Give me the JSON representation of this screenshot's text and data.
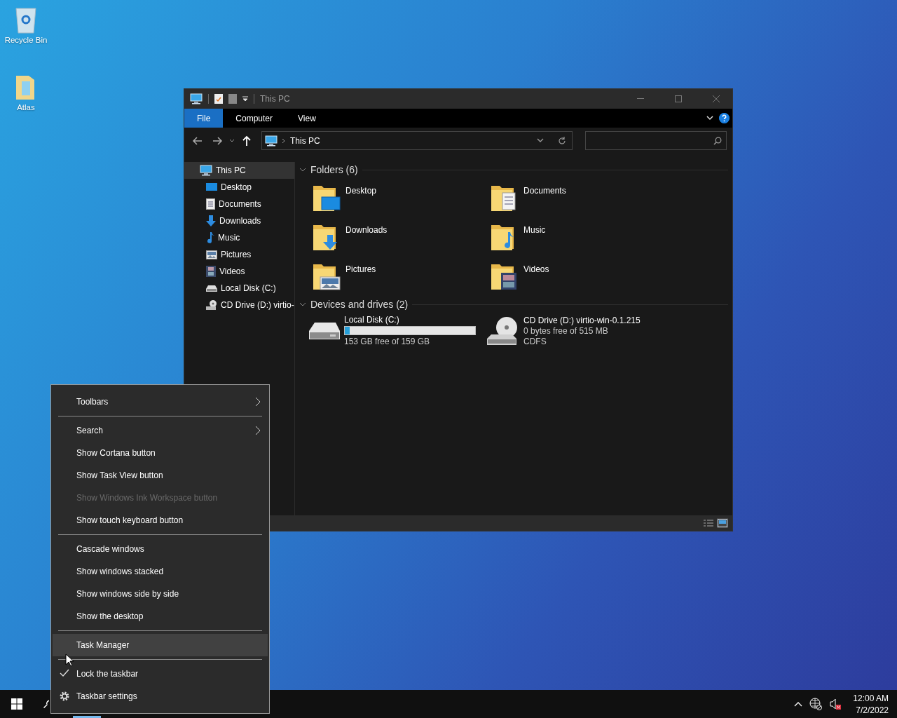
{
  "desktop_icons": [
    {
      "label": "Recycle Bin"
    },
    {
      "label": "Atlas"
    }
  ],
  "explorer": {
    "title": "This PC",
    "ribbon_tabs": [
      {
        "label": "File",
        "selected": true
      },
      {
        "label": "Computer",
        "selected": false
      },
      {
        "label": "View",
        "selected": false
      }
    ],
    "address": "This PC",
    "nav_tree": [
      {
        "label": "This PC",
        "selected": true,
        "children": [
          {
            "label": "Desktop",
            "selected": false
          },
          {
            "label": "Documents",
            "selected": false
          },
          {
            "label": "Downloads",
            "selected": false
          },
          {
            "label": "Music",
            "selected": false
          },
          {
            "label": "Pictures",
            "selected": false
          },
          {
            "label": "Videos",
            "selected": false
          },
          {
            "label": "Local Disk (C:)",
            "selected": false
          },
          {
            "label": "CD Drive (D:) virtio-",
            "selected": false
          }
        ]
      }
    ],
    "folders": {
      "heading": "Folders (6)",
      "expanded": true,
      "items": [
        {
          "name": "Desktop"
        },
        {
          "name": "Documents"
        },
        {
          "name": "Downloads"
        },
        {
          "name": "Music"
        },
        {
          "name": "Pictures"
        },
        {
          "name": "Videos"
        }
      ]
    },
    "drives": {
      "heading": "Devices and drives (2)",
      "expanded": true,
      "items": [
        {
          "kind": "disk",
          "name": "Local Disk (C:)",
          "level": 0.04,
          "details": [
            "153 GB free of 159 GB"
          ]
        },
        {
          "kind": "cd",
          "name": "CD Drive (D:) virtio-win-0.1.215",
          "details": [
            "0 bytes free of 515 MB",
            "CDFS"
          ]
        }
      ]
    },
    "view_buttons": [
      {
        "selected": false
      },
      {
        "selected": true
      }
    ]
  },
  "context_menu": [
    {
      "kind": "submenu",
      "label": "Toolbars",
      "selected": false,
      "disabled": false,
      "checked": false
    },
    {
      "kind": "separator"
    },
    {
      "kind": "submenu",
      "label": "Search",
      "selected": false,
      "disabled": false,
      "checked": false
    },
    {
      "kind": "item",
      "label": "Show Cortana button",
      "selected": false,
      "disabled": false,
      "checked": false
    },
    {
      "kind": "item",
      "label": "Show Task View button",
      "selected": false,
      "disabled": false,
      "checked": false
    },
    {
      "kind": "item",
      "label": "Show Windows Ink Workspace button",
      "selected": false,
      "disabled": true,
      "checked": false
    },
    {
      "kind": "item",
      "label": "Show touch keyboard button",
      "selected": false,
      "disabled": false,
      "checked": false
    },
    {
      "kind": "separator"
    },
    {
      "kind": "item",
      "label": "Cascade windows",
      "selected": false,
      "disabled": false,
      "checked": false
    },
    {
      "kind": "item",
      "label": "Show windows stacked",
      "selected": false,
      "disabled": false,
      "checked": false
    },
    {
      "kind": "item",
      "label": "Show windows side by side",
      "selected": false,
      "disabled": false,
      "checked": false
    },
    {
      "kind": "item",
      "label": "Show the desktop",
      "selected": false,
      "disabled": false,
      "checked": false
    },
    {
      "kind": "separator"
    },
    {
      "kind": "item",
      "label": "Task Manager",
      "selected": true,
      "disabled": false,
      "checked": false
    },
    {
      "kind": "separator"
    },
    {
      "kind": "item",
      "label": "Lock the taskbar",
      "selected": false,
      "disabled": false,
      "checked": true
    },
    {
      "kind": "settings",
      "label": "Taskbar settings",
      "selected": false,
      "disabled": false,
      "checked": false
    }
  ],
  "taskbar": {
    "clock": {
      "time": "12:00 AM",
      "date": "7/2/2022"
    }
  }
}
